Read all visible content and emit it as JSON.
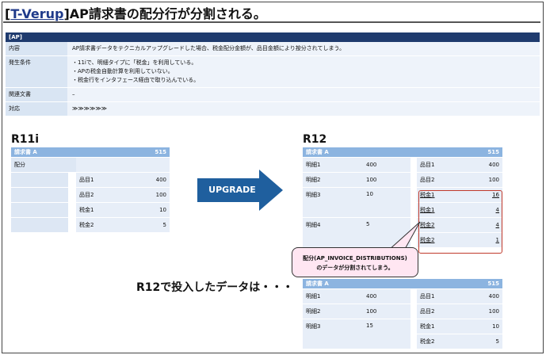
{
  "title": {
    "bracket_open": "[",
    "tag": "T-Verup",
    "bracket_close": "]",
    "text": "AP請求書の配分行が分割される。"
  },
  "info": {
    "header": "[AP]",
    "rows": [
      {
        "key": "内容",
        "lines": [
          "AP請求書データをテクニカルアップグレードした場合、税金配分金額が、品目金額により按分されてしまう。"
        ]
      },
      {
        "key": "発生条件",
        "lines": [
          "・11iで、明細タイプに「税金」を利用している。",
          "・APの税金自動計算を利用していない。",
          "・税金行をインタフェース経由で取り込んでいる。"
        ]
      },
      {
        "key": "関連文書",
        "lines": [
          "–"
        ]
      },
      {
        "key": "対応",
        "lines": [
          "≫≫≫≫≫≫"
        ]
      }
    ]
  },
  "labels": {
    "r11i": "R11i",
    "r12": "R12",
    "upgrade": "UPGRADE"
  },
  "r11i_table": {
    "header": {
      "name": "請求書 A",
      "total": "515"
    },
    "dist_label": "配分",
    "rows": [
      {
        "item": "品目1",
        "amount": "400"
      },
      {
        "item": "品目2",
        "amount": "100"
      },
      {
        "item": "税金1",
        "amount": "10"
      },
      {
        "item": "税金2",
        "amount": "5"
      }
    ]
  },
  "r12_table": {
    "header": {
      "name": "請求書 A",
      "total": "515"
    },
    "rows": [
      {
        "line": "明細1",
        "amount": "400",
        "dist": "品目1",
        "dist_amount": "400"
      },
      {
        "line": "明細2",
        "amount": "100",
        "dist": "品目2",
        "dist_amount": "100"
      },
      {
        "line": "明細3",
        "amount": "10",
        "dist": "税金1",
        "dist_amount": "16"
      },
      {
        "line": "",
        "amount": "",
        "dist": "税金1",
        "dist_amount": "4"
      },
      {
        "line": "明細4",
        "amount": "5",
        "dist": "税金2",
        "dist_amount": "4"
      },
      {
        "line": "",
        "amount": "",
        "dist": "税金2",
        "dist_amount": "1"
      }
    ]
  },
  "callout": {
    "line1": "配分(AP_INVOICE_DISTRIBUTIONS)",
    "line2": "のデータが分割されてしまう。"
  },
  "note": "R12で投入したデータは・・・",
  "r12_bottom_table": {
    "header": {
      "name": "請求書 A",
      "total": "515"
    },
    "rows": [
      {
        "line": "明細1",
        "amount": "400",
        "dist": "品目1",
        "dist_amount": "400"
      },
      {
        "line": "明細2",
        "amount": "100",
        "dist": "品目2",
        "dist_amount": "100"
      },
      {
        "line": "明細3",
        "amount": "15",
        "dist": "税金1",
        "dist_amount": "10"
      },
      {
        "line": "",
        "amount": "",
        "dist": "税金2",
        "dist_amount": "5"
      }
    ]
  }
}
